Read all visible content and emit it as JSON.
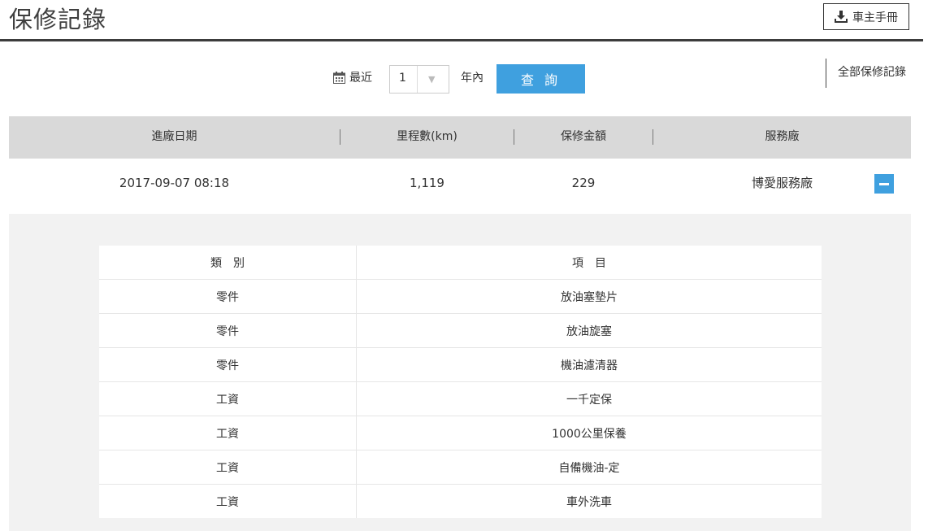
{
  "header": {
    "title": "保修記錄",
    "manual_button": "車主手冊",
    "manual_icon": "download-icon"
  },
  "filter": {
    "calendar_icon": "calendar-icon",
    "label": "最近",
    "year_value": "1",
    "suffix": "年內",
    "query_button": "查 詢",
    "all_records_link": "全部保修記錄"
  },
  "records_table": {
    "columns": [
      "進廠日期",
      "里程數(km)",
      "保修金額",
      "服務廠"
    ],
    "rows": [
      {
        "date": "2017-09-07 08:18",
        "mileage": "1,119",
        "amount": "229",
        "service_center": "博愛服務廠"
      }
    ]
  },
  "detail": {
    "columns": [
      "類　別",
      "項　目"
    ],
    "items": [
      {
        "category": "零件",
        "item": "放油塞墊片"
      },
      {
        "category": "零件",
        "item": "放油旋塞"
      },
      {
        "category": "零件",
        "item": "機油濾清器"
      },
      {
        "category": "工資",
        "item": "一千定保"
      },
      {
        "category": "工資",
        "item": "1000公里保養"
      },
      {
        "category": "工資",
        "item": "自備機油-定"
      },
      {
        "category": "工資",
        "item": "車外洗車"
      }
    ]
  },
  "colors": {
    "accent": "#3fa0df",
    "header_bg": "#d9d9d9",
    "panel_bg": "#f2f2f2"
  }
}
